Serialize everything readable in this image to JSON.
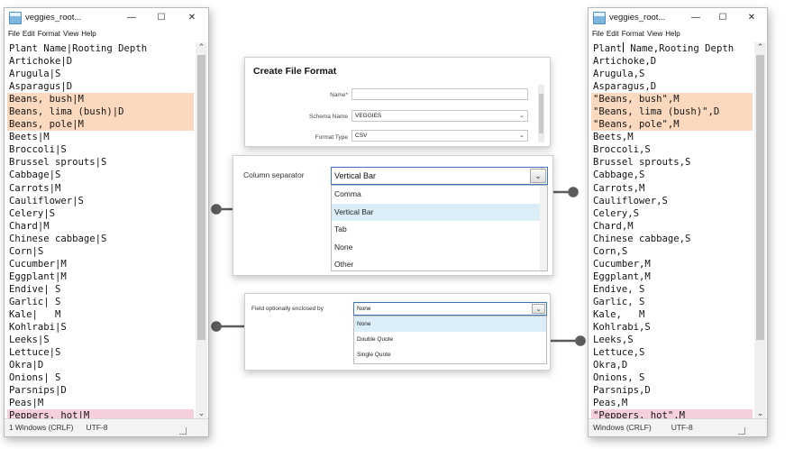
{
  "left_window": {
    "title": "veggies_root...",
    "controls": {
      "minimize": "—",
      "maximize": "☐",
      "close": "✕"
    },
    "menu": [
      "File",
      "Edit",
      "Format",
      "View",
      "Help"
    ],
    "lines": [
      {
        "text": "Plant Name|Rooting Depth",
        "hl": ""
      },
      {
        "text": "Artichoke|D",
        "hl": ""
      },
      {
        "text": "Arugula|S",
        "hl": ""
      },
      {
        "text": "Asparagus|D",
        "hl": ""
      },
      {
        "text": "Beans, bush|M",
        "hl": "orange"
      },
      {
        "text": "Beans, lima (bush)|D",
        "hl": "orange"
      },
      {
        "text": "Beans, pole|M",
        "hl": "orange"
      },
      {
        "text": "Beets|M",
        "hl": ""
      },
      {
        "text": "Broccoli|S",
        "hl": ""
      },
      {
        "text": "Brussel sprouts|S",
        "hl": ""
      },
      {
        "text": "Cabbage|S",
        "hl": ""
      },
      {
        "text": "Carrots|M",
        "hl": ""
      },
      {
        "text": "Cauliflower|S",
        "hl": ""
      },
      {
        "text": "Celery|S",
        "hl": ""
      },
      {
        "text": "Chard|M",
        "hl": ""
      },
      {
        "text": "Chinese cabbage|S",
        "hl": ""
      },
      {
        "text": "Corn|S",
        "hl": ""
      },
      {
        "text": "Cucumber|M",
        "hl": ""
      },
      {
        "text": "Eggplant|M",
        "hl": ""
      },
      {
        "text": "Endive| S",
        "hl": ""
      },
      {
        "text": "Garlic| S",
        "hl": ""
      },
      {
        "text": "Kale|   M",
        "hl": ""
      },
      {
        "text": "Kohlrabi|S",
        "hl": ""
      },
      {
        "text": "Leeks|S",
        "hl": ""
      },
      {
        "text": "Lettuce|S",
        "hl": ""
      },
      {
        "text": "Okra|D",
        "hl": ""
      },
      {
        "text": "Onions| S",
        "hl": ""
      },
      {
        "text": "Parsnips|D",
        "hl": ""
      },
      {
        "text": "Peas|M",
        "hl": ""
      },
      {
        "text": "Peppers, hot|M",
        "hl": "pink"
      }
    ],
    "status": {
      "position": "1",
      "line_ending": "Windows (CRLF)",
      "encoding": "UTF-8"
    }
  },
  "right_window": {
    "title": "veggies_root...",
    "controls": {
      "minimize": "—",
      "maximize": "☐",
      "close": "✕"
    },
    "menu": [
      "File",
      "Edit",
      "Format",
      "View",
      "Help"
    ],
    "first_line_a": "Plant",
    "first_line_b": " Name,Rooting Depth",
    "lines": [
      {
        "text": "Artichoke,D",
        "hl": ""
      },
      {
        "text": "Arugula,S",
        "hl": ""
      },
      {
        "text": "Asparagus,D",
        "hl": ""
      },
      {
        "text": "\"Beans, bush\",M",
        "hl": "orange"
      },
      {
        "text": "\"Beans, lima (bush)\",D",
        "hl": "orange"
      },
      {
        "text": "\"Beans, pole\",M",
        "hl": "orange"
      },
      {
        "text": "Beets,M",
        "hl": ""
      },
      {
        "text": "Broccoli,S",
        "hl": ""
      },
      {
        "text": "Brussel sprouts,S",
        "hl": ""
      },
      {
        "text": "Cabbage,S",
        "hl": ""
      },
      {
        "text": "Carrots,M",
        "hl": ""
      },
      {
        "text": "Cauliflower,S",
        "hl": ""
      },
      {
        "text": "Celery,S",
        "hl": ""
      },
      {
        "text": "Chard,M",
        "hl": ""
      },
      {
        "text": "Chinese cabbage,S",
        "hl": ""
      },
      {
        "text": "Corn,S",
        "hl": ""
      },
      {
        "text": "Cucumber,M",
        "hl": ""
      },
      {
        "text": "Eggplant,M",
        "hl": ""
      },
      {
        "text": "Endive, S",
        "hl": ""
      },
      {
        "text": "Garlic, S",
        "hl": ""
      },
      {
        "text": "Kale,   M",
        "hl": ""
      },
      {
        "text": "Kohlrabi,S",
        "hl": ""
      },
      {
        "text": "Leeks,S",
        "hl": ""
      },
      {
        "text": "Lettuce,S",
        "hl": ""
      },
      {
        "text": "Okra,D",
        "hl": ""
      },
      {
        "text": "Onions, S",
        "hl": ""
      },
      {
        "text": "Parsnips,D",
        "hl": ""
      },
      {
        "text": "Peas,M",
        "hl": ""
      },
      {
        "text": "\"Peppers, hot\",M",
        "hl": "pink"
      }
    ],
    "status": {
      "line_ending": "Windows (CRLF)",
      "encoding": "UTF-8"
    }
  },
  "create_form": {
    "title": "Create File Format",
    "name_label": "Name*",
    "name_value": "",
    "schema_label": "Schema Name",
    "schema_value": "VEGGIES",
    "type_label": "Format Type",
    "type_value": "CSV"
  },
  "column_separator": {
    "label": "Column separator",
    "selected": "Vertical Bar",
    "options": [
      "Comma",
      "Vertical Bar",
      "Tab",
      "None",
      "Other"
    ],
    "highlighted_index": 1
  },
  "field_enclosed": {
    "label": "Field optionally enclosed by",
    "selected": "None",
    "options": [
      "None",
      "Double Quote",
      "Single Quote"
    ],
    "highlighted_index": 0
  },
  "colors": {
    "highlight_orange": "#fbd9bf",
    "highlight_pink": "#f5cfdc",
    "connector": "#5c5c5c",
    "dropdown_selection": "#dbeef8",
    "focus_border": "#3e78bd"
  },
  "icons": {
    "dropdown": "chevron-down-icon",
    "notepad": "notepad-icon"
  }
}
